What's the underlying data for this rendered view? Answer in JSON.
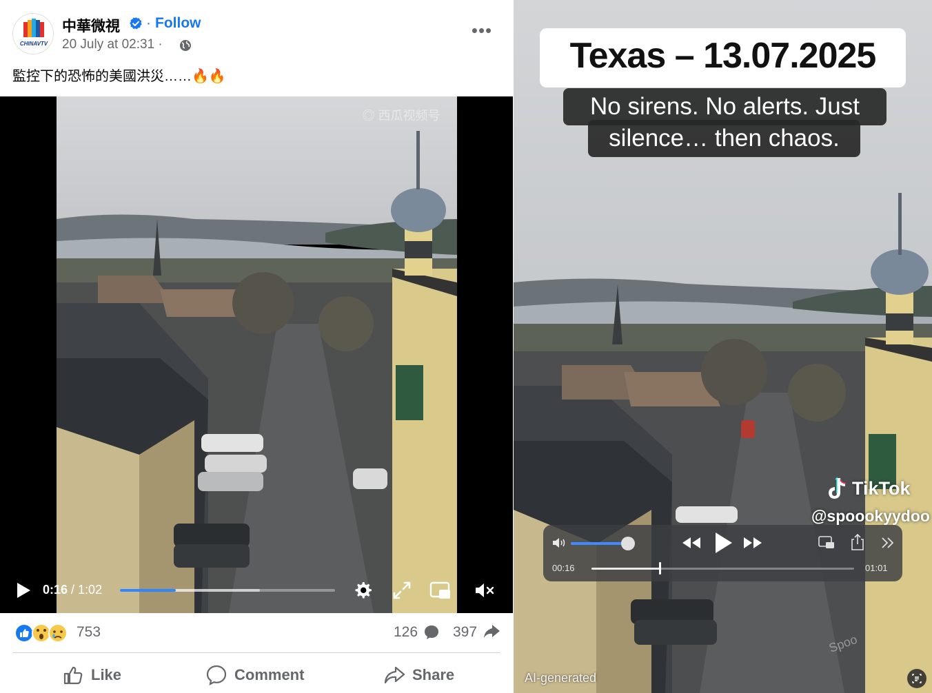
{
  "facebook_post": {
    "page_name": "中華微視",
    "avatar_label": "CHINAVTV",
    "follow_separator": "·",
    "follow_label": "Follow",
    "date": "20 July at 02:31 ·",
    "caption": "監控下的恐怖的美國洪災……🔥🔥",
    "video": {
      "current_time": "0:16",
      "duration": "/ 1:02",
      "progress_fraction": 0.26,
      "buffered_fraction": 0.65
    },
    "stats": {
      "reactions": "753",
      "comments": "126",
      "shares": "397"
    },
    "actions": {
      "like": "Like",
      "comment": "Comment",
      "share": "Share"
    },
    "colors": {
      "accent": "#1877f2",
      "progress": "#2d88ff"
    }
  },
  "tiktok_video": {
    "title": "Texas – 13.07.2025",
    "subtitle_line1": "No sirens. No alerts. Just",
    "subtitle_line2": "silence… then chaos.",
    "brand": "TikTok",
    "handle": "@spoookyydoo",
    "player": {
      "current_time": "00:16",
      "end_time": "01:01",
      "volume_fraction": 0.92,
      "progress_fraction": 0.26
    },
    "ai_label": "AI-generated"
  }
}
